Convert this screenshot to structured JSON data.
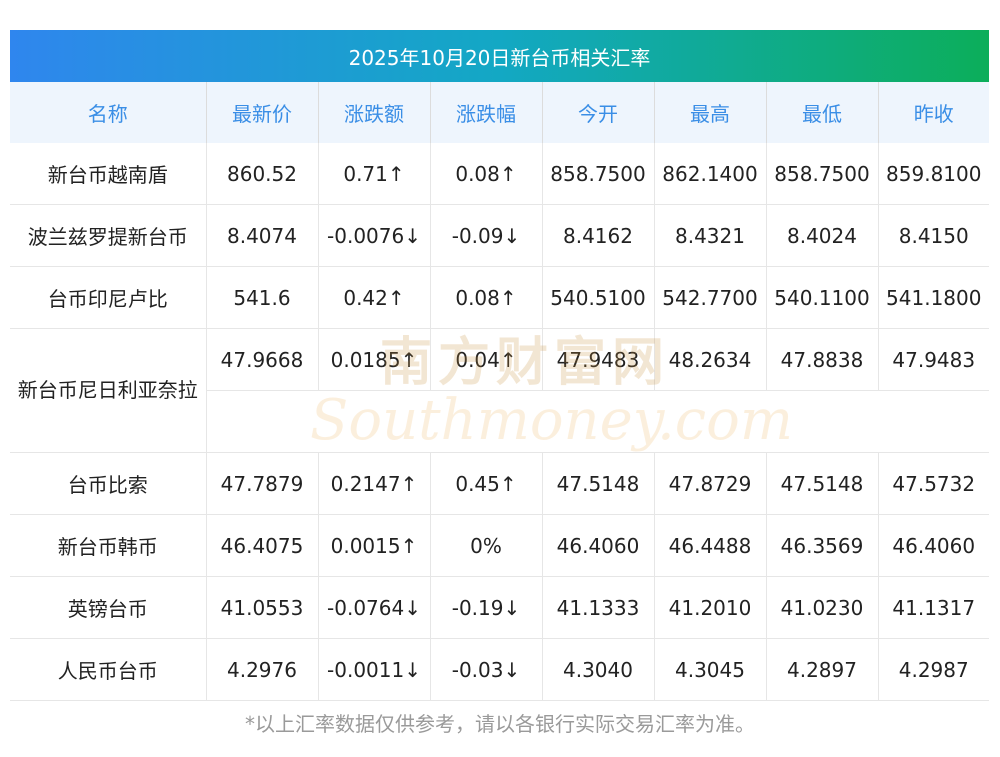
{
  "title": "2025年10月20日新台币相关汇率",
  "columns": [
    "名称",
    "最新价",
    "涨跌额",
    "涨跌幅",
    "今开",
    "最高",
    "最低",
    "昨收"
  ],
  "rows": [
    {
      "name": "新台币越南盾",
      "latest": "860.52",
      "change": "0.71↑",
      "pct": "0.08↑",
      "open": "858.7500",
      "high": "862.1400",
      "low": "858.7500",
      "prev": "859.8100",
      "trend": "up"
    },
    {
      "name": "波兰兹罗提新台币",
      "latest": "8.4074",
      "change": "-0.0076↓",
      "pct": "-0.09↓",
      "open": "8.4162",
      "high": "8.4321",
      "low": "8.4024",
      "prev": "8.4150",
      "trend": "down"
    },
    {
      "name": "台币印尼卢比",
      "latest": "541.6",
      "change": "0.42↑",
      "pct": "0.08↑",
      "open": "540.5100",
      "high": "542.7700",
      "low": "540.1100",
      "prev": "541.1800",
      "trend": "up"
    },
    {
      "name": "新台币尼日利亚奈拉",
      "latest": "47.9668",
      "change": "0.0185↑",
      "pct": "0.04↑",
      "open": "47.9483",
      "high": "48.2634",
      "low": "47.8838",
      "prev": "47.9483",
      "trend": "up"
    },
    {
      "name": "台币比索",
      "latest": "47.7879",
      "change": "0.2147↑",
      "pct": "0.45↑",
      "open": "47.5148",
      "high": "47.8729",
      "low": "47.5148",
      "prev": "47.5732",
      "trend": "up"
    },
    {
      "name": "新台币韩币",
      "latest": "46.4075",
      "change": "0.0015↑",
      "pct": "0%",
      "open": "46.4060",
      "high": "46.4488",
      "low": "46.3569",
      "prev": "46.4060",
      "trend": "flat-pct"
    },
    {
      "name": "英镑台币",
      "latest": "41.0553",
      "change": "-0.0764↓",
      "pct": "-0.19↓",
      "open": "41.1333",
      "high": "41.2010",
      "low": "41.0230",
      "prev": "41.1317",
      "trend": "down"
    },
    {
      "name": "人民币台币",
      "latest": "4.2976",
      "change": "-0.0011↓",
      "pct": "-0.03↓",
      "open": "4.3040",
      "high": "4.3045",
      "low": "4.2897",
      "prev": "4.2987",
      "trend": "down"
    }
  ],
  "watermark": {
    "cn": "南方财富网",
    "en": "Southmoney.com"
  },
  "footnote": "*以上汇率数据仅供参考，请以各银行实际交易汇率为准。",
  "colors": {
    "up": "#e02020",
    "down": "#169b23",
    "header_text": "#3a8ee6",
    "title_gradient_start": "#2f86ee",
    "title_gradient_end": "#0cae5a"
  }
}
